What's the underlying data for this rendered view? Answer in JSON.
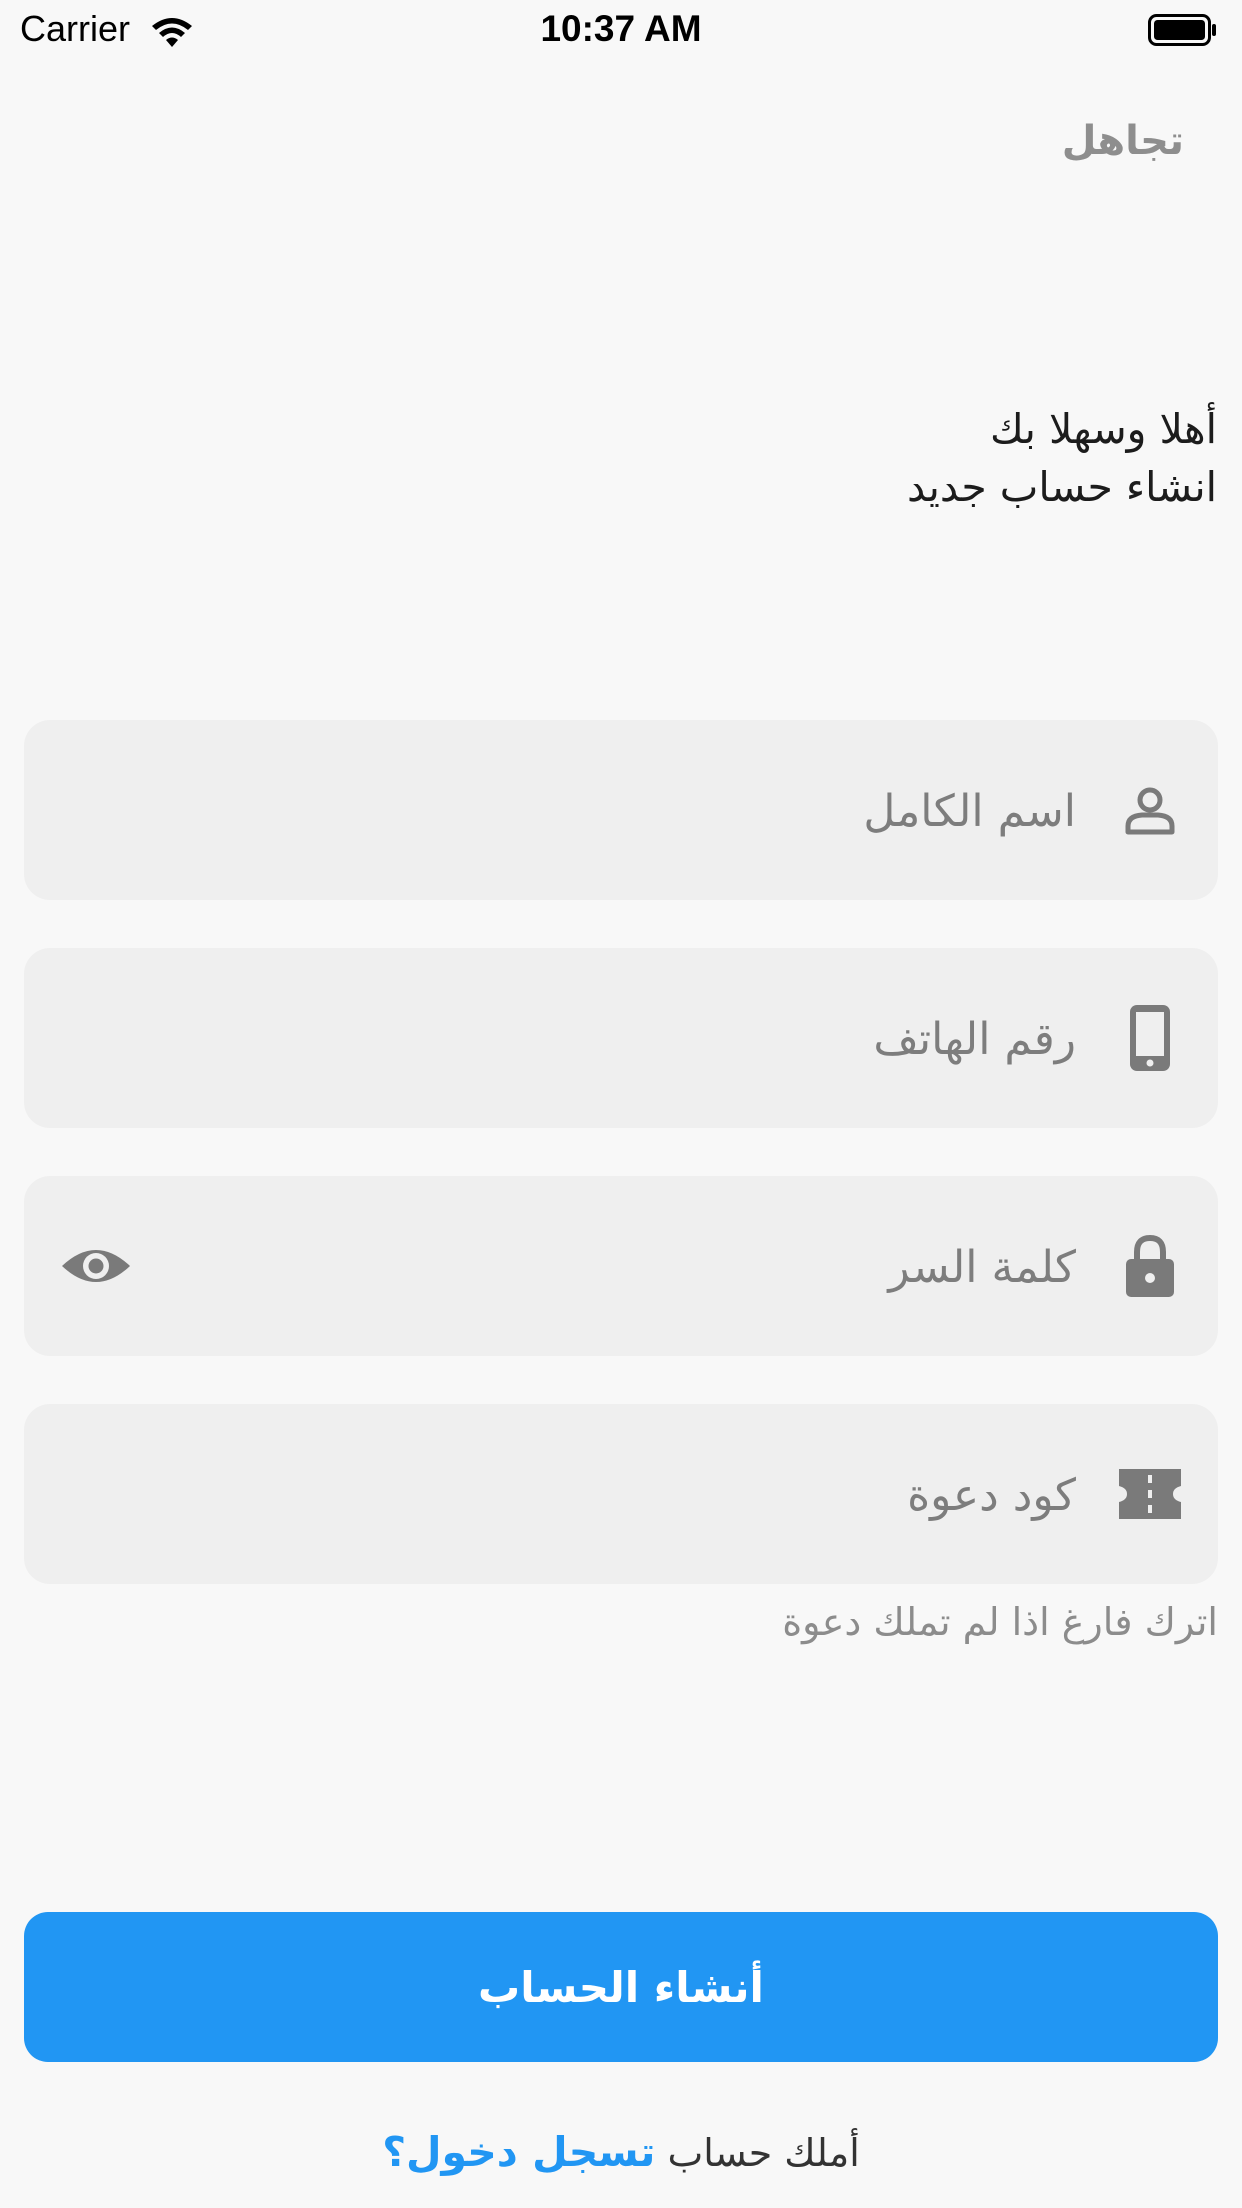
{
  "status_bar": {
    "carrier": "Carrier",
    "time": "10:37 AM"
  },
  "header": {
    "skip_label": "تجاهل"
  },
  "welcome": {
    "line1": "أهلا وسهلا بك",
    "line2": "انشاء حساب جديد"
  },
  "form": {
    "full_name": {
      "placeholder": "اسم الكامل",
      "icon": "person-icon"
    },
    "phone": {
      "placeholder": "رقم الهاتف",
      "icon": "phone-icon"
    },
    "password": {
      "placeholder": "كلمة السر",
      "icon": "lock-icon",
      "toggle_icon": "eye-icon"
    },
    "invite_code": {
      "placeholder": "كود دعوة",
      "icon": "ticket-icon"
    },
    "invite_hint": "اترك فارغ اذا لم تملك دعوة"
  },
  "actions": {
    "create_account_label": "أنشاء الحساب",
    "have_account_text": "أملك حساب",
    "login_link_label": "تسجل دخول؟"
  },
  "colors": {
    "accent": "#2196f3",
    "field_bg": "#efefef",
    "page_bg": "#f8f8f8",
    "icon_gray": "#7a7a7a"
  }
}
